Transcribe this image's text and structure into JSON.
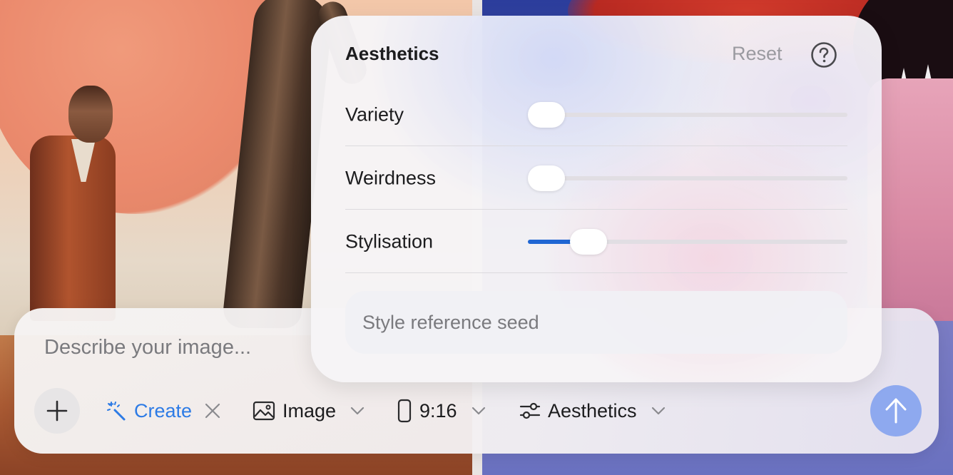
{
  "prompt": {
    "placeholder": "Describe your image...",
    "value": ""
  },
  "toolbar": {
    "add_icon": "plus-icon",
    "mode": {
      "label": "Create",
      "icon": "magic-wand-icon",
      "color": "#2d7be5"
    },
    "type": {
      "label": "Image",
      "icon": "image-icon"
    },
    "aspect_ratio": {
      "label": "9:16",
      "icon": "phone-portrait-icon"
    },
    "aesthetics": {
      "label": "Aesthetics",
      "icon": "sliders-icon"
    },
    "submit_icon": "arrow-up-icon",
    "submit_color": "#8ea9ef"
  },
  "aesthetics_panel": {
    "title": "Aesthetics",
    "reset_label": "Reset",
    "help_icon": "question-circle-icon",
    "sliders": [
      {
        "label": "Variety",
        "value": 0
      },
      {
        "label": "Weirdness",
        "value": 0
      },
      {
        "label": "Stylisation",
        "value": 0.15
      }
    ],
    "seed": {
      "placeholder": "Style reference seed",
      "value": ""
    },
    "accent_color": "#1f66d3"
  }
}
